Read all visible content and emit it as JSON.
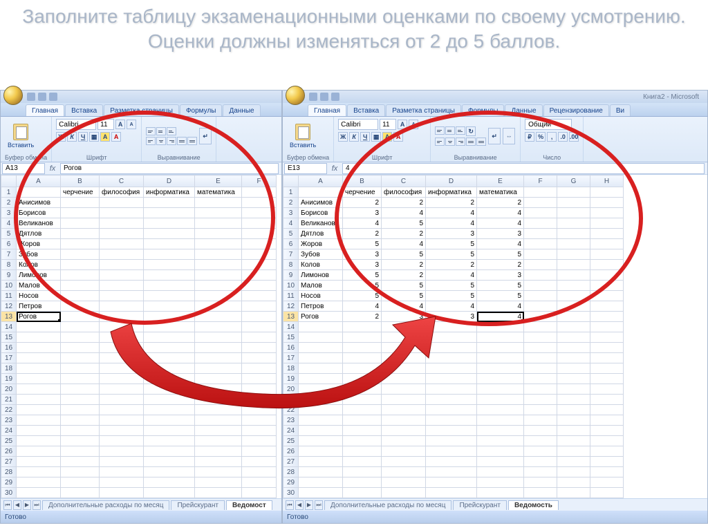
{
  "slide_title": "Заполните таблицу экзаменационными оценками по своему усмотрению. Оценки должны изменяться от 2 до 5 баллов.",
  "window": {
    "doc_title": "Книга2 - Microsoft"
  },
  "tabs": {
    "home": "Главная",
    "insert": "Вставка",
    "pagelayout": "Разметка страницы",
    "formulas": "Формулы",
    "data": "Данные",
    "review": "Рецензирование",
    "view": "Ви"
  },
  "groups": {
    "clipboard": "Буфер обмена",
    "paste": "Вставить",
    "font": "Шрифт",
    "alignment": "Выравнивание",
    "number": "Число"
  },
  "font": {
    "name": "Calibri",
    "size": "11"
  },
  "number_format": "Общий",
  "percent_val": "%",
  "left": {
    "active_cell": "A13",
    "formula_value": "Рогов",
    "headers": [
      "A",
      "B",
      "C",
      "D",
      "E",
      "F"
    ],
    "col_labels": [
      "",
      "черчение",
      "философия",
      "информатика",
      "математика",
      ""
    ],
    "rows": [
      {
        "n": 2,
        "name": "Анисимов"
      },
      {
        "n": 3,
        "name": "Борисов"
      },
      {
        "n": 4,
        "name": "Великанов"
      },
      {
        "n": 5,
        "name": "Дятлов"
      },
      {
        "n": 6,
        "name": "Жоров"
      },
      {
        "n": 7,
        "name": "Зубов"
      },
      {
        "n": 8,
        "name": "Колов"
      },
      {
        "n": 9,
        "name": "Лимонов"
      },
      {
        "n": 10,
        "name": "Малов"
      },
      {
        "n": 11,
        "name": "Носов"
      },
      {
        "n": 12,
        "name": "Петров"
      },
      {
        "n": 13,
        "name": "Рогов"
      }
    ]
  },
  "right": {
    "active_cell": "E13",
    "formula_value": "4",
    "headers": [
      "A",
      "B",
      "C",
      "D",
      "E",
      "F",
      "G",
      "H"
    ],
    "col_labels": [
      "",
      "черчение",
      "философия",
      "информатика",
      "математика",
      "",
      "",
      ""
    ],
    "rows": [
      {
        "n": 2,
        "name": "Анисимов",
        "b": 2,
        "c": 2,
        "d": 2,
        "e": 2
      },
      {
        "n": 3,
        "name": "Борисов",
        "b": 3,
        "c": 4,
        "d": 4,
        "e": 4
      },
      {
        "n": 4,
        "name": "Великанов",
        "b": 4,
        "c": 5,
        "d": 4,
        "e": 4
      },
      {
        "n": 5,
        "name": "Дятлов",
        "b": 2,
        "c": 2,
        "d": 3,
        "e": 3
      },
      {
        "n": 6,
        "name": "Жоров",
        "b": 5,
        "c": 4,
        "d": 5,
        "e": 4
      },
      {
        "n": 7,
        "name": "Зубов",
        "b": 3,
        "c": 5,
        "d": 5,
        "e": 5
      },
      {
        "n": 8,
        "name": "Колов",
        "b": 3,
        "c": 2,
        "d": 2,
        "e": 2
      },
      {
        "n": 9,
        "name": "Лимонов",
        "b": 5,
        "c": 2,
        "d": 4,
        "e": 3
      },
      {
        "n": 10,
        "name": "Малов",
        "b": 5,
        "c": 5,
        "d": 5,
        "e": 5
      },
      {
        "n": 11,
        "name": "Носов",
        "b": 5,
        "c": 5,
        "d": 5,
        "e": 5
      },
      {
        "n": 12,
        "name": "Петров",
        "b": 4,
        "c": 4,
        "d": 4,
        "e": 4
      },
      {
        "n": 13,
        "name": "Рогов",
        "b": 2,
        "c": 3,
        "d": 3,
        "e": 4
      }
    ]
  },
  "sheet_tabs": {
    "sheet1": "Дополнительные расходы по месяц",
    "sheet2": "Прейскурант",
    "sheet3": "Ведомость",
    "sheet3_short": "Ведомост"
  },
  "status_text": "Готово"
}
